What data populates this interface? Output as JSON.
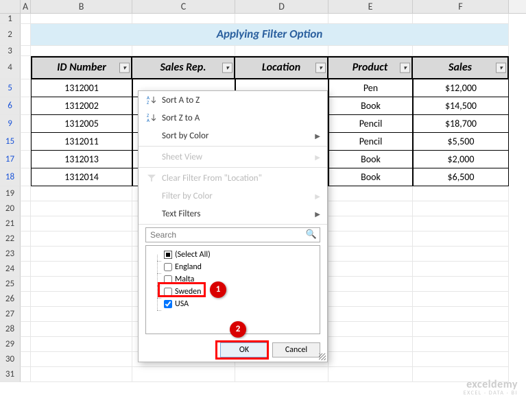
{
  "columns": [
    "A",
    "B",
    "C",
    "D",
    "E",
    "F"
  ],
  "title": "Applying Filter Option",
  "headers": {
    "b": "ID Number",
    "c": "Sales Rep.",
    "d": "Location",
    "e": "Product",
    "f": "Sales"
  },
  "rows": [
    {
      "num": "5",
      "id": "1312001",
      "product": "Pen",
      "sales": "$12,000"
    },
    {
      "num": "6",
      "id": "1312002",
      "product": "Book",
      "sales": "$14,500"
    },
    {
      "num": "9",
      "id": "1312005",
      "product": "Pencil",
      "sales": "$18,700"
    },
    {
      "num": "15",
      "id": "1312011",
      "product": "Pencil",
      "sales": "$5,500"
    },
    {
      "num": "17",
      "id": "1312013",
      "product": "Book",
      "sales": "$2,000"
    },
    {
      "num": "18",
      "id": "1312014",
      "product": "Book",
      "sales": "$6,500"
    }
  ],
  "tail_rows": [
    "19",
    "20",
    "21",
    "22",
    "23",
    "24",
    "25",
    "26",
    "27",
    "28",
    "29",
    "30",
    "31"
  ],
  "menu": {
    "sort_az": "Sort A to Z",
    "sort_za": "Sort Z to A",
    "sort_color": "Sort by Color",
    "sheet_view": "Sheet View",
    "clear": "Clear Filter From \"Location\"",
    "filter_color": "Filter by Color",
    "text_filters": "Text Filters",
    "search_placeholder": "Search",
    "items": {
      "all": "(Select All)",
      "england": "England",
      "malta": "Malta",
      "sweden": "Sweden",
      "usa": "USA"
    },
    "ok": "OK",
    "cancel": "Cancel"
  },
  "callouts": {
    "c1": "1",
    "c2": "2"
  },
  "watermark": {
    "line1": "exceldemy",
    "line2": "EXCEL · DATA · BI"
  },
  "chart_data": {
    "type": "table",
    "title": "Applying Filter Option",
    "columns": [
      "ID Number",
      "Sales Rep.",
      "Location",
      "Product",
      "Sales"
    ],
    "rows": [
      [
        "1312001",
        "",
        "",
        "Pen",
        12000
      ],
      [
        "1312002",
        "",
        "",
        "Book",
        14500
      ],
      [
        "1312005",
        "",
        "",
        "Pencil",
        18700
      ],
      [
        "1312011",
        "",
        "",
        "Pencil",
        5500
      ],
      [
        "1312013",
        "",
        "",
        "Book",
        2000
      ],
      [
        "1312014",
        "",
        "",
        "Book",
        6500
      ]
    ]
  }
}
